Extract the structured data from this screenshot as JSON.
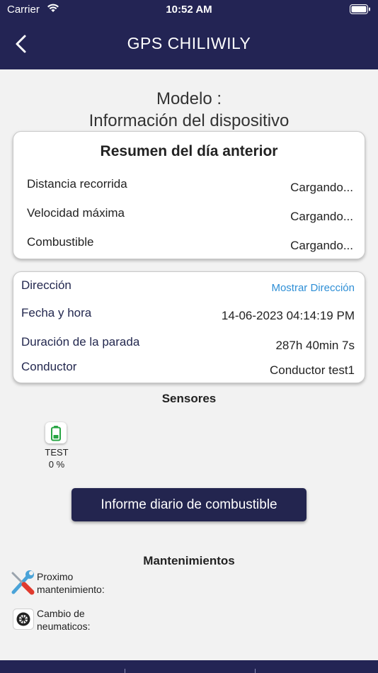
{
  "status_bar": {
    "carrier": "Carrier",
    "time": "10:52 AM"
  },
  "nav": {
    "title": "GPS CHILIWILY"
  },
  "header": {
    "modelo_line1": "Modelo :",
    "modelo_line2": "Información del dispositivo"
  },
  "summary": {
    "title": "Resumen del día anterior",
    "rows": [
      {
        "label": "Distancia recorrida",
        "value": "Cargando..."
      },
      {
        "label": "Velocidad máxima",
        "value": "Cargando..."
      },
      {
        "label": "Combustible",
        "value": "Cargando..."
      }
    ]
  },
  "details": {
    "address_label": "Dirección",
    "address_link": "Mostrar Dirección",
    "datetime_label": "Fecha y hora",
    "datetime_value": "14-06-2023 04:14:19 PM",
    "stop_label": "Duración de la parada",
    "stop_value": "287h 40min 7s",
    "driver_label": "Conductor",
    "driver_value": "Conductor test1"
  },
  "sensors": {
    "title": "Sensores",
    "items": [
      {
        "name": "TEST",
        "value": "0 %",
        "icon": "battery-icon"
      }
    ]
  },
  "fuel_report_button": "Informe diario de combustible",
  "maintenance": {
    "title": "Mantenimientos",
    "items": [
      {
        "label_line1": "Proximo",
        "label_line2": "mantenimiento:",
        "icon": "tools-icon"
      },
      {
        "label_line1": "Cambio de",
        "label_line2": "neumaticos:",
        "icon": "tire-icon"
      }
    ]
  },
  "colors": {
    "header_bg": "#232454",
    "button_bg": "#23254f",
    "link": "#2f8fd6",
    "background": "#f2f2f2",
    "sensor_green": "#27a543"
  }
}
